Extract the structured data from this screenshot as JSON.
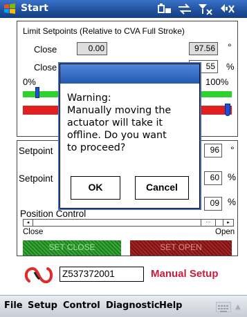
{
  "title_bar": {
    "start_label": "Start",
    "tray_icons": [
      "battery-icon",
      "connectivity-icon",
      "signal-off-icon",
      "volume-mute-icon"
    ]
  },
  "limit_setpoints": {
    "heading": "Limit Setpoints (Relative to CVA Full Stroke)",
    "close_label_1": "Close",
    "close_value_1": "0.00",
    "close_label_2": "Close",
    "open_value_1": "97.56",
    "unit_degree": "°",
    "open_value_2": "55",
    "unit_percent": "%",
    "range_min": "0%",
    "range_max": "100%"
  },
  "setpoints": {
    "label_1": "Setpoint",
    "value_1": "96",
    "unit_1": "°",
    "label_2": "Setpoint",
    "value_2": "60",
    "unit_2": "%",
    "value_3": "09",
    "unit_3": "%",
    "position_control_label": "Position Control",
    "close_label": "Close",
    "open_label": "Open",
    "set_close_label": "SET CLOSE",
    "set_open_label": "SET OPEN"
  },
  "dialog": {
    "message_lines": [
      "Warning:",
      "Manually moving the",
      "actuator will take it",
      "offline. Do you want",
      "to proceed?"
    ],
    "ok_label": "OK",
    "cancel_label": "Cancel"
  },
  "device": {
    "serial": "Z537372001",
    "mode_label": "Manual Setup"
  },
  "menu": {
    "items": [
      "File",
      "Setup",
      "Control",
      "Diagnostic",
      "Help"
    ]
  },
  "colors": {
    "title_bar": "#1f4f9c",
    "green_bar": "#2fd12f",
    "red_bar": "#e02020",
    "accent_red": "#cc1a3a"
  }
}
